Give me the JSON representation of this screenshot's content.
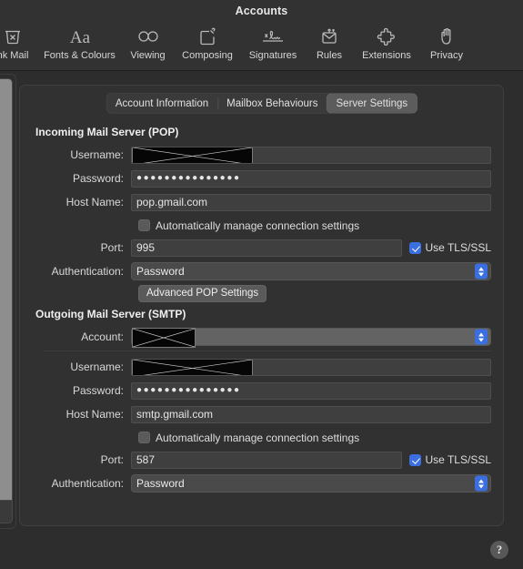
{
  "window": {
    "title": "Accounts"
  },
  "toolbar": {
    "items": [
      {
        "label": "Junk Mail",
        "icon": "junk-mail-icon",
        "truncated_label": "nk Mail"
      },
      {
        "label": "Fonts & Colours",
        "icon": "fonts-colours-icon"
      },
      {
        "label": "Viewing",
        "icon": "viewing-icon"
      },
      {
        "label": "Composing",
        "icon": "composing-icon"
      },
      {
        "label": "Signatures",
        "icon": "signatures-icon"
      },
      {
        "label": "Rules",
        "icon": "rules-icon"
      },
      {
        "label": "Extensions",
        "icon": "extensions-icon"
      },
      {
        "label": "Privacy",
        "icon": "privacy-icon"
      }
    ]
  },
  "tabs": [
    {
      "label": "Account Information",
      "selected": false
    },
    {
      "label": "Mailbox Behaviours",
      "selected": false
    },
    {
      "label": "Server Settings",
      "selected": true
    }
  ],
  "incoming": {
    "section_title": "Incoming Mail Server (POP)",
    "username_label": "Username:",
    "username_value": "",
    "username_redacted": true,
    "password_label": "Password:",
    "password_value": "●●●●●●●●●●●●●●●",
    "host_label": "Host Name:",
    "host_value": "pop.gmail.com",
    "auto_manage_label": "Automatically manage connection settings",
    "auto_manage_checked": false,
    "port_label": "Port:",
    "port_value": "995",
    "tls_label": "Use TLS/SSL",
    "tls_checked": true,
    "auth_label": "Authentication:",
    "auth_value": "Password",
    "advanced_button": "Advanced POP Settings"
  },
  "outgoing": {
    "section_title": "Outgoing Mail Server (SMTP)",
    "account_label": "Account:",
    "account_value": "",
    "account_redacted": true,
    "username_label": "Username:",
    "username_value": "",
    "username_redacted": true,
    "password_label": "Password:",
    "password_value": "●●●●●●●●●●●●●●●",
    "host_label": "Host Name:",
    "host_value": "smtp.gmail.com",
    "auto_manage_label": "Automatically manage connection settings",
    "auto_manage_checked": false,
    "port_label": "Port:",
    "port_value": "587",
    "tls_label": "Use TLS/SSL",
    "tls_checked": true,
    "auth_label": "Authentication:",
    "auth_value": "Password"
  },
  "help": {
    "label": "?"
  },
  "colors": {
    "accent": "#3b6fe0",
    "window_bg": "#2d2d2d",
    "panel_bg": "#313131",
    "toolbar_bg": "#323232",
    "field_bg": "#3f3f3f",
    "redaction": "#060606"
  }
}
